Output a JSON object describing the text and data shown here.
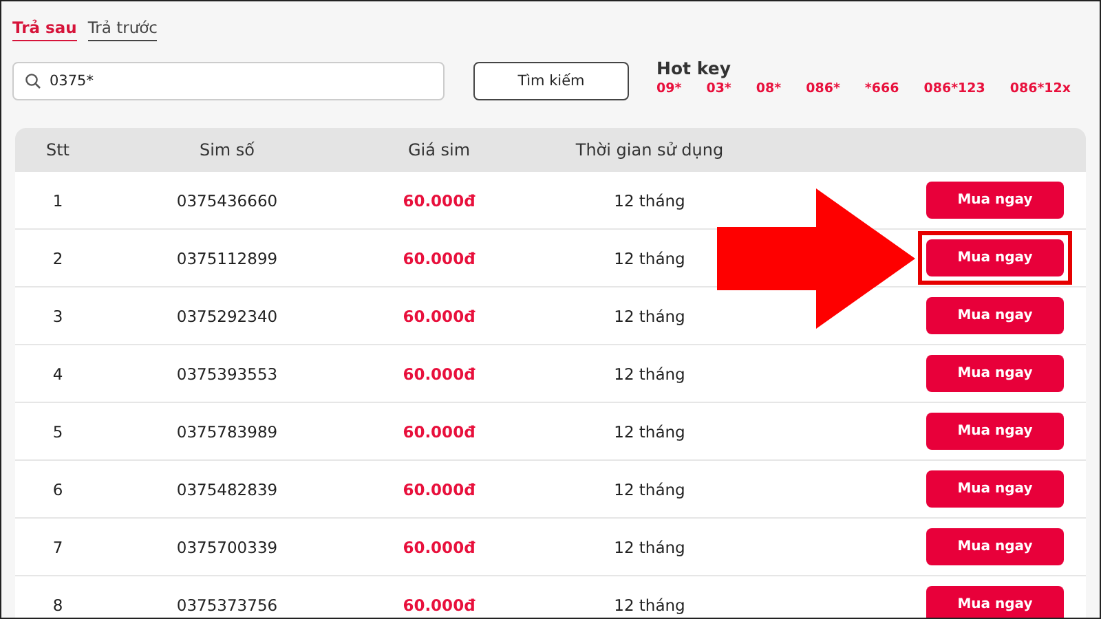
{
  "tabs": [
    {
      "label": "Trả sau",
      "selected": true
    },
    {
      "label": "Trả trước",
      "selected": false
    }
  ],
  "search": {
    "value": "0375*"
  },
  "search_button": "Tìm kiếm",
  "hot_key": {
    "title": "Hot key",
    "items": [
      "09*",
      "03*",
      "08*",
      "086*",
      "*666",
      "086*123",
      "086*12x"
    ]
  },
  "table": {
    "columns": [
      "Stt",
      "Sim số",
      "Giá sim",
      "Thời gian sử dụng"
    ],
    "rows": [
      {
        "stt": "1",
        "number": "0375436660",
        "price": "60.000đ",
        "duration": "12 tháng",
        "action": "Mua ngay",
        "highlighted": false
      },
      {
        "stt": "2",
        "number": "0375112899",
        "price": "60.000đ",
        "duration": "12 tháng",
        "action": "Mua ngay",
        "highlighted": true
      },
      {
        "stt": "3",
        "number": "0375292340",
        "price": "60.000đ",
        "duration": "12 tháng",
        "action": "Mua ngay",
        "highlighted": false
      },
      {
        "stt": "4",
        "number": "0375393553",
        "price": "60.000đ",
        "duration": "12 tháng",
        "action": "Mua ngay",
        "highlighted": false
      },
      {
        "stt": "5",
        "number": "0375783989",
        "price": "60.000đ",
        "duration": "12 tháng",
        "action": "Mua ngay",
        "highlighted": false
      },
      {
        "stt": "6",
        "number": "0375482839",
        "price": "60.000đ",
        "duration": "12 tháng",
        "action": "Mua ngay",
        "highlighted": false
      },
      {
        "stt": "7",
        "number": "0375700339",
        "price": "60.000đ",
        "duration": "12 tháng",
        "action": "Mua ngay",
        "highlighted": false
      },
      {
        "stt": "8",
        "number": "0375373756",
        "price": "60.000đ",
        "duration": "12 tháng",
        "action": "Mua ngay",
        "highlighted": false
      }
    ]
  }
}
